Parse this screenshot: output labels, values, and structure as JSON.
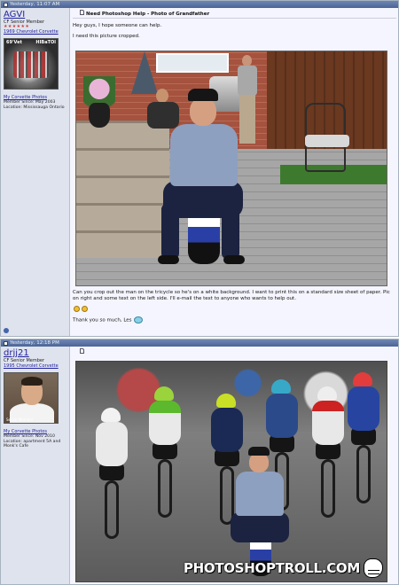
{
  "post1": {
    "timestamp": "Yesterday, 11:07 AM",
    "user": {
      "name": "AGVI",
      "title": "CF Senior Member",
      "stars": "★★★★★★",
      "car_link": "1969 Chevrolet Corvette",
      "avatar_tags": [
        "69'Vet",
        "HIBaTOl"
      ],
      "photos_link": "My Corvette Photos",
      "member_since": "Member Since: May 2003",
      "location": "Location: Mississauga Ontario"
    },
    "title": "Need Photoshop Help - Photo of Grandfather",
    "greeting": "Hey guys, I hope someone can help.",
    "intro": "I need this picture cropped.",
    "request": "Can you crop out the man on the tricycle so he's on a white background. I want to print this on a standard size sheet of paper. Pic on right and some text on the left side. I'll e-mail the text to anyone who wants to help out.",
    "thanks": "Thank you so much, Les"
  },
  "post2": {
    "timestamp": "Yesterday, 12:18 PM",
    "user": {
      "name": "drjj21",
      "title": "CF Senior Member",
      "car_link": "1995 Chevrolet Corvette",
      "avatar_caption": "Senior Member",
      "photos_link": "My Corvette Photos",
      "member_since": "Member Since: Nov 2010",
      "location": "Location: apartment 5A and Monk's Cafe"
    },
    "watermark": "PHOTOSHOPTROLL.COM"
  },
  "icons": {
    "post_icon": "document-icon",
    "post_title_icon": "page-icon",
    "troll_face": "troll-face-icon",
    "smiley": "smiley-icon"
  },
  "colors": {
    "header_bar": "#4c6596",
    "sidebar_bg": "#dfe3ee",
    "link_blue": "#22229c",
    "post_bg": "#f5f5ff"
  }
}
